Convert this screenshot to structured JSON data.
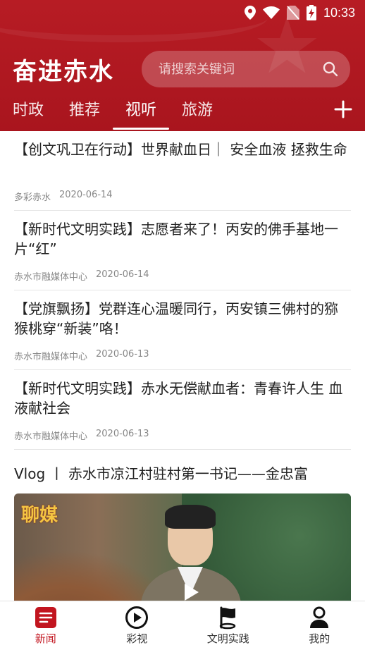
{
  "status_bar": {
    "time": "10:33"
  },
  "header": {
    "app_title": "奋进赤水"
  },
  "search": {
    "placeholder": "请搜索关键词"
  },
  "tabs": [
    {
      "label": "时政"
    },
    {
      "label": "推荐"
    },
    {
      "label": "视听",
      "active": true
    },
    {
      "label": "旅游"
    }
  ],
  "news": [
    {
      "title": "【创文巩卫在行动】世界献血日｜ 安全血液 拯救生命",
      "source": "多彩赤水",
      "date": "2020-06-14"
    },
    {
      "title": "【新时代文明实践】志愿者来了！丙安的佛手基地一片“红”",
      "source": "赤水市融媒体中心",
      "date": "2020-06-14"
    },
    {
      "title": "【党旗飘扬】党群连心温暖同行，丙安镇三佛村的猕猴桃穿“新装”咯！",
      "source": "赤水市融媒体中心",
      "date": "2020-06-13"
    },
    {
      "title": "【新时代文明实践】赤水无偿献血者：青春许人生 血液献社会",
      "source": "赤水市融媒体中心",
      "date": "2020-06-13"
    }
  ],
  "video": {
    "title": "Vlog  丨  赤水市凉江村驻村第一书记——金忠富",
    "overlay_text": "聊媒"
  },
  "bottom_nav": [
    {
      "label": "新闻",
      "icon": "news-icon",
      "active": true
    },
    {
      "label": "彩视",
      "icon": "play-circle-icon"
    },
    {
      "label": "文明实践",
      "icon": "flag-icon"
    },
    {
      "label": "我的",
      "icon": "user-icon"
    }
  ],
  "colors": {
    "brand": "#b71c24",
    "active_nav": "#c2151f"
  }
}
